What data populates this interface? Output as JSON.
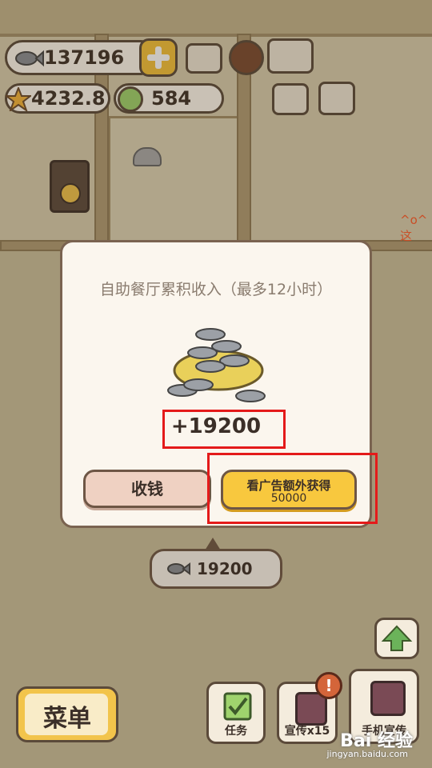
{
  "currency": {
    "fish": "137196",
    "stars": "4232.8",
    "coins": "584"
  },
  "dialog": {
    "title": "自助餐厅累积收入（最多12小时）",
    "amount": "+19200",
    "collect_label": "收钱",
    "ad_label": "看广告额外获得",
    "ad_amount": "50000"
  },
  "bubble": {
    "amount": "19200"
  },
  "side_text": "^o^这",
  "bottom": {
    "menu": "菜单",
    "tasks": "任务",
    "promo15": "宣传x15",
    "phone_promo": "手机宣传"
  },
  "watermark": {
    "brand": "Bai 经验",
    "url": "jingyan.baidu.com"
  },
  "icons": [
    "fish-icon",
    "plus-icon",
    "star-icon",
    "coin-icon",
    "ranking-icon",
    "gear-icon",
    "book-icon",
    "camera-icon",
    "newspaper-icon",
    "clock-icon",
    "up-arrow-icon",
    "checklist-icon",
    "poster-icon",
    "alert-icon"
  ],
  "colors": {
    "accent": "#f8c83e",
    "highlight": "#e41a1a",
    "panel": "#fbf6ee"
  }
}
